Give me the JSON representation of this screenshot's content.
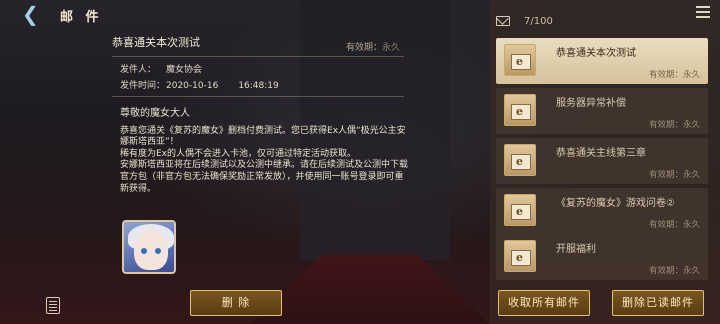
{
  "header": {
    "title": "邮 件"
  },
  "detail": {
    "title": "恭喜通关本次测试",
    "expiry_label": "有效期：",
    "expiry_value": "永久",
    "sender_label": "发件人：",
    "sender": "魔女协会",
    "time_label": "发件时间：",
    "date": "2020-10-16",
    "time": "16:48:19",
    "greeting": "尊敬的魔女大人",
    "body": [
      "恭喜您通关《复苏的魔女》删档付费测试。您已获得Ex人偶“极光公主安娜斯塔西亚”！",
      "稀有度为Ex的人偶不会进入卡池，仅可通过特定活动获取。",
      "安娜斯塔西亚将在后续测试以及公测中继承。请在后续测试及公测中下载官方包（非官方包无法确保奖励正常发放），并使用同一账号登录即可重新获得。"
    ],
    "delete_label": "删 除"
  },
  "mailbox": {
    "count": "7/100",
    "items": [
      {
        "name": "恭喜通关本次测试",
        "expiry": "有效期：永久",
        "selected": true
      },
      {
        "name": "服务器异常补偿",
        "expiry": "有效期：永久",
        "selected": false
      },
      {
        "name": "恭喜通关主线第三章",
        "expiry": "有效期：永久",
        "selected": false
      },
      {
        "name": "《复苏的魔女》游戏问卷②",
        "expiry": "有效期：永久",
        "selected": false
      },
      {
        "name": "开服福利",
        "expiry": "有效期：永久",
        "selected": false
      }
    ],
    "collect_all_label": "收取所有邮件",
    "delete_read_label": "删除已读邮件"
  }
}
